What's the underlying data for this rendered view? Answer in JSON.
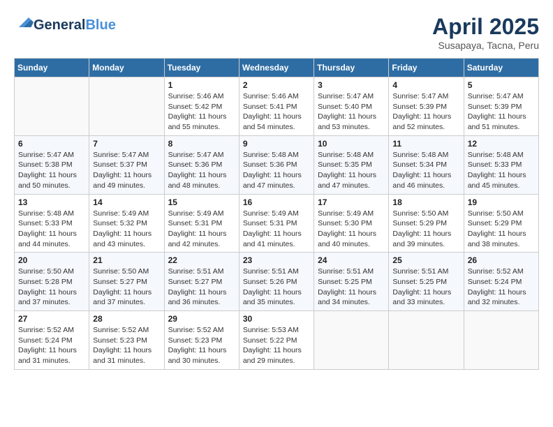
{
  "header": {
    "logo_line1": "General",
    "logo_line2": "Blue",
    "month_title": "April 2025",
    "subtitle": "Susapaya, Tacna, Peru"
  },
  "weekdays": [
    "Sunday",
    "Monday",
    "Tuesday",
    "Wednesday",
    "Thursday",
    "Friday",
    "Saturday"
  ],
  "weeks": [
    [
      {
        "day": "",
        "sunrise": "",
        "sunset": "",
        "daylight": ""
      },
      {
        "day": "",
        "sunrise": "",
        "sunset": "",
        "daylight": ""
      },
      {
        "day": "1",
        "sunrise": "Sunrise: 5:46 AM",
        "sunset": "Sunset: 5:42 PM",
        "daylight": "Daylight: 11 hours and 55 minutes."
      },
      {
        "day": "2",
        "sunrise": "Sunrise: 5:46 AM",
        "sunset": "Sunset: 5:41 PM",
        "daylight": "Daylight: 11 hours and 54 minutes."
      },
      {
        "day": "3",
        "sunrise": "Sunrise: 5:47 AM",
        "sunset": "Sunset: 5:40 PM",
        "daylight": "Daylight: 11 hours and 53 minutes."
      },
      {
        "day": "4",
        "sunrise": "Sunrise: 5:47 AM",
        "sunset": "Sunset: 5:39 PM",
        "daylight": "Daylight: 11 hours and 52 minutes."
      },
      {
        "day": "5",
        "sunrise": "Sunrise: 5:47 AM",
        "sunset": "Sunset: 5:39 PM",
        "daylight": "Daylight: 11 hours and 51 minutes."
      }
    ],
    [
      {
        "day": "6",
        "sunrise": "Sunrise: 5:47 AM",
        "sunset": "Sunset: 5:38 PM",
        "daylight": "Daylight: 11 hours and 50 minutes."
      },
      {
        "day": "7",
        "sunrise": "Sunrise: 5:47 AM",
        "sunset": "Sunset: 5:37 PM",
        "daylight": "Daylight: 11 hours and 49 minutes."
      },
      {
        "day": "8",
        "sunrise": "Sunrise: 5:47 AM",
        "sunset": "Sunset: 5:36 PM",
        "daylight": "Daylight: 11 hours and 48 minutes."
      },
      {
        "day": "9",
        "sunrise": "Sunrise: 5:48 AM",
        "sunset": "Sunset: 5:36 PM",
        "daylight": "Daylight: 11 hours and 47 minutes."
      },
      {
        "day": "10",
        "sunrise": "Sunrise: 5:48 AM",
        "sunset": "Sunset: 5:35 PM",
        "daylight": "Daylight: 11 hours and 47 minutes."
      },
      {
        "day": "11",
        "sunrise": "Sunrise: 5:48 AM",
        "sunset": "Sunset: 5:34 PM",
        "daylight": "Daylight: 11 hours and 46 minutes."
      },
      {
        "day": "12",
        "sunrise": "Sunrise: 5:48 AM",
        "sunset": "Sunset: 5:33 PM",
        "daylight": "Daylight: 11 hours and 45 minutes."
      }
    ],
    [
      {
        "day": "13",
        "sunrise": "Sunrise: 5:48 AM",
        "sunset": "Sunset: 5:33 PM",
        "daylight": "Daylight: 11 hours and 44 minutes."
      },
      {
        "day": "14",
        "sunrise": "Sunrise: 5:49 AM",
        "sunset": "Sunset: 5:32 PM",
        "daylight": "Daylight: 11 hours and 43 minutes."
      },
      {
        "day": "15",
        "sunrise": "Sunrise: 5:49 AM",
        "sunset": "Sunset: 5:31 PM",
        "daylight": "Daylight: 11 hours and 42 minutes."
      },
      {
        "day": "16",
        "sunrise": "Sunrise: 5:49 AM",
        "sunset": "Sunset: 5:31 PM",
        "daylight": "Daylight: 11 hours and 41 minutes."
      },
      {
        "day": "17",
        "sunrise": "Sunrise: 5:49 AM",
        "sunset": "Sunset: 5:30 PM",
        "daylight": "Daylight: 11 hours and 40 minutes."
      },
      {
        "day": "18",
        "sunrise": "Sunrise: 5:50 AM",
        "sunset": "Sunset: 5:29 PM",
        "daylight": "Daylight: 11 hours and 39 minutes."
      },
      {
        "day": "19",
        "sunrise": "Sunrise: 5:50 AM",
        "sunset": "Sunset: 5:29 PM",
        "daylight": "Daylight: 11 hours and 38 minutes."
      }
    ],
    [
      {
        "day": "20",
        "sunrise": "Sunrise: 5:50 AM",
        "sunset": "Sunset: 5:28 PM",
        "daylight": "Daylight: 11 hours and 37 minutes."
      },
      {
        "day": "21",
        "sunrise": "Sunrise: 5:50 AM",
        "sunset": "Sunset: 5:27 PM",
        "daylight": "Daylight: 11 hours and 37 minutes."
      },
      {
        "day": "22",
        "sunrise": "Sunrise: 5:51 AM",
        "sunset": "Sunset: 5:27 PM",
        "daylight": "Daylight: 11 hours and 36 minutes."
      },
      {
        "day": "23",
        "sunrise": "Sunrise: 5:51 AM",
        "sunset": "Sunset: 5:26 PM",
        "daylight": "Daylight: 11 hours and 35 minutes."
      },
      {
        "day": "24",
        "sunrise": "Sunrise: 5:51 AM",
        "sunset": "Sunset: 5:25 PM",
        "daylight": "Daylight: 11 hours and 34 minutes."
      },
      {
        "day": "25",
        "sunrise": "Sunrise: 5:51 AM",
        "sunset": "Sunset: 5:25 PM",
        "daylight": "Daylight: 11 hours and 33 minutes."
      },
      {
        "day": "26",
        "sunrise": "Sunrise: 5:52 AM",
        "sunset": "Sunset: 5:24 PM",
        "daylight": "Daylight: 11 hours and 32 minutes."
      }
    ],
    [
      {
        "day": "27",
        "sunrise": "Sunrise: 5:52 AM",
        "sunset": "Sunset: 5:24 PM",
        "daylight": "Daylight: 11 hours and 31 minutes."
      },
      {
        "day": "28",
        "sunrise": "Sunrise: 5:52 AM",
        "sunset": "Sunset: 5:23 PM",
        "daylight": "Daylight: 11 hours and 31 minutes."
      },
      {
        "day": "29",
        "sunrise": "Sunrise: 5:52 AM",
        "sunset": "Sunset: 5:23 PM",
        "daylight": "Daylight: 11 hours and 30 minutes."
      },
      {
        "day": "30",
        "sunrise": "Sunrise: 5:53 AM",
        "sunset": "Sunset: 5:22 PM",
        "daylight": "Daylight: 11 hours and 29 minutes."
      },
      {
        "day": "",
        "sunrise": "",
        "sunset": "",
        "daylight": ""
      },
      {
        "day": "",
        "sunrise": "",
        "sunset": "",
        "daylight": ""
      },
      {
        "day": "",
        "sunrise": "",
        "sunset": "",
        "daylight": ""
      }
    ]
  ]
}
